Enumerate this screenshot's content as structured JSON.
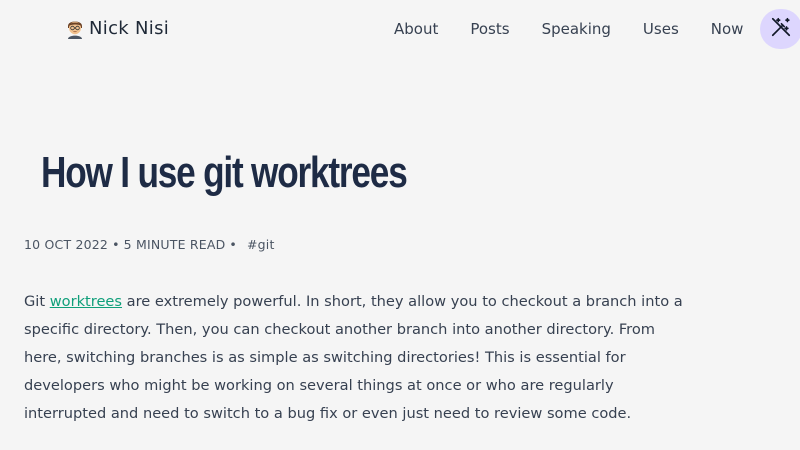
{
  "header": {
    "brand_emoji": "🧑‍💻",
    "brand_name": "Nick Nisi",
    "nav": [
      {
        "label": "About"
      },
      {
        "label": "Posts"
      },
      {
        "label": "Speaking"
      },
      {
        "label": "Uses"
      },
      {
        "label": "Now"
      }
    ],
    "theme_toggle_icon": "magic-wand-icon"
  },
  "article": {
    "title": "How I use git worktrees",
    "date": "10 OCT 2022",
    "read_time": "5 MINUTE READ",
    "bullet": "•",
    "tag": "#git",
    "intro_before_link": "Git ",
    "intro_link": "worktrees",
    "intro_after_link": " are extremely powerful. In short, they allow you to checkout a branch into a specific directory. Then, you can checkout another branch into another directory. From here, switching branches is as simple as switching directories! This is essential for developers who might be working on several things at once or who are regularly interrupted and need to switch to a bug fix or even just need to review some code."
  },
  "colors": {
    "background": "#f5f5f5",
    "title": "#1e2b45",
    "link": "#0f9f7a",
    "toggle_bg": "#ddd6fe"
  }
}
